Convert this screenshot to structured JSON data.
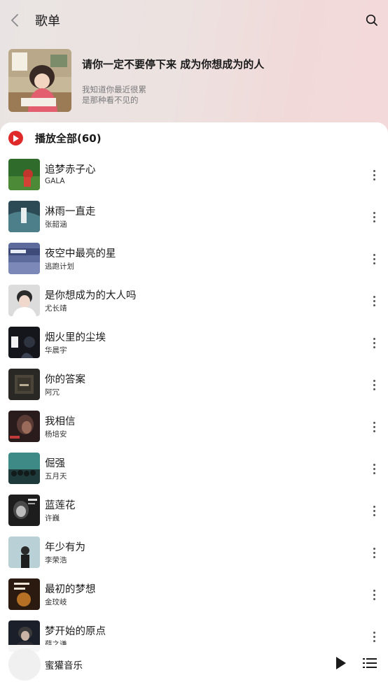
{
  "header": {
    "title": "歌单",
    "back_icon": "chevron-left-icon",
    "search_icon": "search-icon"
  },
  "playlist": {
    "name": "请你一定不要停下来 成为你想成为的人",
    "desc_line1": "我知道你最近很累",
    "desc_line2": "是那种看不见的"
  },
  "play_all": {
    "label": "播放全部(60)",
    "accent": "#e02a2a"
  },
  "songs": [
    {
      "title": "追梦赤子心",
      "artist": "GALA"
    },
    {
      "title": "淋雨一直走",
      "artist": "张韶涵"
    },
    {
      "title": "夜空中最亮的星",
      "artist": "逃跑计划"
    },
    {
      "title": "是你想成为的大人吗",
      "artist": "尤长靖"
    },
    {
      "title": "烟火里的尘埃",
      "artist": "华晨宇"
    },
    {
      "title": "你的答案",
      "artist": "阿冗"
    },
    {
      "title": "我相信",
      "artist": "杨培安"
    },
    {
      "title": "倔强",
      "artist": "五月天"
    },
    {
      "title": "蓝莲花",
      "artist": "许巍"
    },
    {
      "title": "年少有为",
      "artist": "李荣浩"
    },
    {
      "title": "最初的梦想",
      "artist": "金玟岐"
    },
    {
      "title": "梦开始的原点",
      "artist": "薛之谦"
    }
  ],
  "player": {
    "title": "蜜獾音乐",
    "play_icon": "play-icon",
    "list_icon": "playlist-icon"
  }
}
